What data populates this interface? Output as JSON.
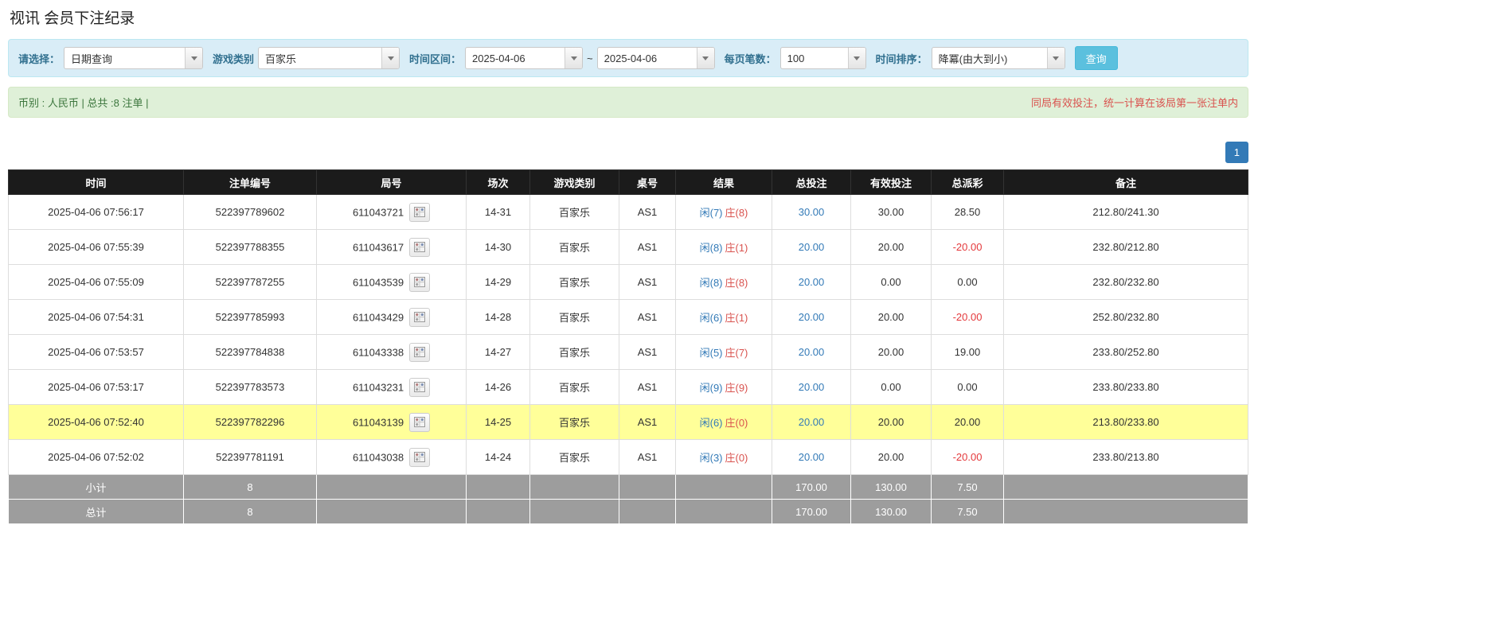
{
  "page": {
    "title": "视讯 会员下注纪录"
  },
  "filters": {
    "select_label": "请选择：",
    "select_value": "日期查询",
    "game_type_label": "游戏类别",
    "game_type_value": "百家乐",
    "time_range_label": "时间区间：",
    "date_from": "2025-04-06",
    "range_separator": "~",
    "date_to": "2025-04-06",
    "page_size_label": "每页笔数：",
    "page_size_value": "100",
    "sort_label": "时间排序：",
    "sort_value": "降冪(由大到小)",
    "search_button_label": "查询"
  },
  "summary": {
    "left": "币别 : 人民币 | 总共 :8 注单 |",
    "right": "同局有效投注，统一计算在该局第一张注单内"
  },
  "pagination": {
    "current": "1"
  },
  "table": {
    "headers": [
      "时间",
      "注单编号",
      "局号",
      "场次",
      "游戏类别",
      "桌号",
      "结果",
      "总投注",
      "有效投注",
      "总派彩",
      "备注"
    ],
    "rows": [
      {
        "time": "2025-04-06 07:56:17",
        "bet_id": "522397789602",
        "round_id": "611043721",
        "session": "14-31",
        "game": "百家乐",
        "table_no": "AS1",
        "result_player": "闲(7)",
        "result_banker": "庄(8)",
        "total_bet": "30.00",
        "valid_bet": "30.00",
        "payout": "28.50",
        "note": "212.80/241.30",
        "highlighted": false
      },
      {
        "time": "2025-04-06 07:55:39",
        "bet_id": "522397788355",
        "round_id": "611043617",
        "session": "14-30",
        "game": "百家乐",
        "table_no": "AS1",
        "result_player": "闲(8)",
        "result_banker": "庄(1)",
        "total_bet": "20.00",
        "valid_bet": "20.00",
        "payout": "-20.00",
        "note": "232.80/212.80",
        "highlighted": false
      },
      {
        "time": "2025-04-06 07:55:09",
        "bet_id": "522397787255",
        "round_id": "611043539",
        "session": "14-29",
        "game": "百家乐",
        "table_no": "AS1",
        "result_player": "闲(8)",
        "result_banker": "庄(8)",
        "total_bet": "20.00",
        "valid_bet": "0.00",
        "payout": "0.00",
        "note": "232.80/232.80",
        "highlighted": false
      },
      {
        "time": "2025-04-06 07:54:31",
        "bet_id": "522397785993",
        "round_id": "611043429",
        "session": "14-28",
        "game": "百家乐",
        "table_no": "AS1",
        "result_player": "闲(6)",
        "result_banker": "庄(1)",
        "total_bet": "20.00",
        "valid_bet": "20.00",
        "payout": "-20.00",
        "note": "252.80/232.80",
        "highlighted": false
      },
      {
        "time": "2025-04-06 07:53:57",
        "bet_id": "522397784838",
        "round_id": "611043338",
        "session": "14-27",
        "game": "百家乐",
        "table_no": "AS1",
        "result_player": "闲(5)",
        "result_banker": "庄(7)",
        "total_bet": "20.00",
        "valid_bet": "20.00",
        "payout": "19.00",
        "note": "233.80/252.80",
        "highlighted": false
      },
      {
        "time": "2025-04-06 07:53:17",
        "bet_id": "522397783573",
        "round_id": "611043231",
        "session": "14-26",
        "game": "百家乐",
        "table_no": "AS1",
        "result_player": "闲(9)",
        "result_banker": "庄(9)",
        "total_bet": "20.00",
        "valid_bet": "0.00",
        "payout": "0.00",
        "note": "233.80/233.80",
        "highlighted": false
      },
      {
        "time": "2025-04-06 07:52:40",
        "bet_id": "522397782296",
        "round_id": "611043139",
        "session": "14-25",
        "game": "百家乐",
        "table_no": "AS1",
        "result_player": "闲(6)",
        "result_banker": "庄(0)",
        "total_bet": "20.00",
        "valid_bet": "20.00",
        "payout": "20.00",
        "note": "213.80/233.80",
        "highlighted": true
      },
      {
        "time": "2025-04-06 07:52:02",
        "bet_id": "522397781191",
        "round_id": "611043038",
        "session": "14-24",
        "game": "百家乐",
        "table_no": "AS1",
        "result_player": "闲(3)",
        "result_banker": "庄(0)",
        "total_bet": "20.00",
        "valid_bet": "20.00",
        "payout": "-20.00",
        "note": "233.80/213.80",
        "highlighted": false
      }
    ],
    "subtotal": {
      "label": "小计",
      "count": "8",
      "total_bet": "170.00",
      "valid_bet": "130.00",
      "payout": "7.50"
    },
    "total": {
      "label": "总计",
      "count": "8",
      "total_bet": "170.00",
      "valid_bet": "130.00",
      "payout": "7.50"
    }
  },
  "colors": {
    "accent_blue": "#337ab7",
    "banker_red": "#d9534f",
    "negative_red": "#e4393c",
    "filter_bg": "#d9edf7",
    "summary_bg": "#dff0d8",
    "header_bg": "#1b1b1b",
    "highlight": "#ffff99",
    "footer_bg": "#9d9d9d",
    "search_bg": "#5bc0de"
  }
}
